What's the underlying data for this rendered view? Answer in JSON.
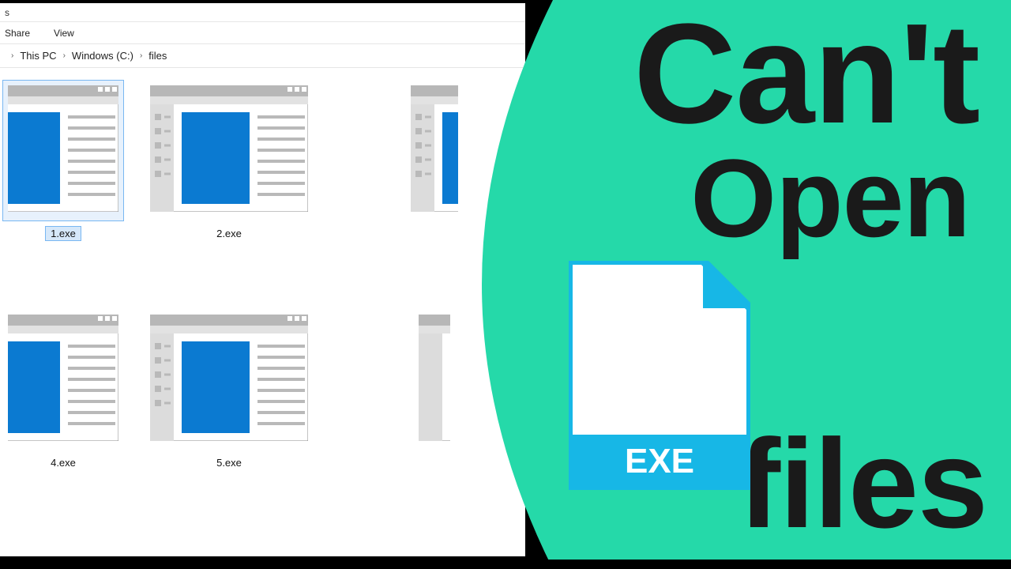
{
  "titlebar": {
    "suffix": "s"
  },
  "ribbon": {
    "share": "Share",
    "view": "View"
  },
  "breadcrumb": {
    "thispc": "This PC",
    "drive": "Windows (C:)",
    "folder": "files"
  },
  "files": {
    "f0": "1.exe",
    "f1": "2.exe",
    "f2": "",
    "f3": "4.exe",
    "f4": "5.exe",
    "f5": ""
  },
  "overlay": {
    "line1": "Can't",
    "line2": "Open",
    "line3": "files",
    "ext": "EXE"
  },
  "colors": {
    "accent": "#25d9a9",
    "fileicon": "#17b7e6",
    "exe_stripe": "#0f9dcc",
    "thumb_blue": "#0b7ad1"
  }
}
